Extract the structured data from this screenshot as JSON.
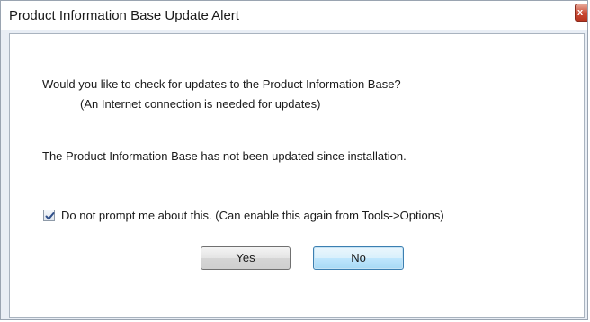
{
  "window": {
    "title": "Product Information Base Update Alert",
    "close_label": "x"
  },
  "message": {
    "question": "Would you like to check for updates to the Product Information Base?",
    "note": "(An Internet connection is needed for updates)",
    "status": "The Product Information Base has not been updated since installation."
  },
  "option": {
    "checked": true,
    "label": "Do not prompt me about this.   (Can enable this again  from Tools->Options)"
  },
  "buttons": {
    "yes": "Yes",
    "no": "No"
  },
  "colors": {
    "close_button": "#c94a35",
    "default_button_border": "#3c7fb1",
    "checkmark": "#2f4f8a"
  }
}
